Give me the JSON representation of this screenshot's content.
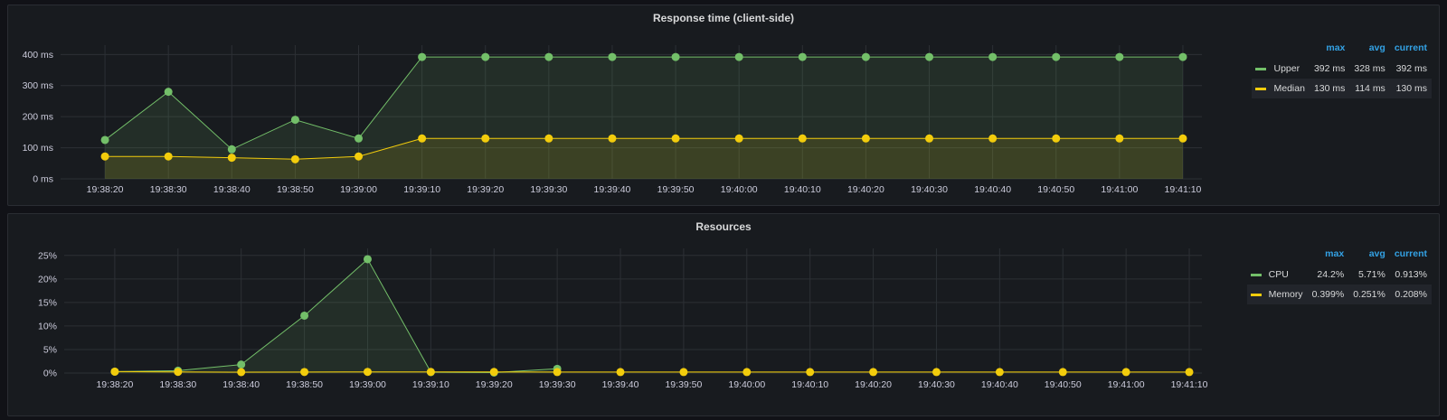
{
  "colors": {
    "green": "#73bf69",
    "yellow": "#f2cc0c",
    "grid": "#2c3035",
    "text": "#ccccdc"
  },
  "panels": [
    {
      "title": "Response time (client-side)",
      "legend_headers": [
        "max",
        "avg",
        "current"
      ],
      "legend": [
        {
          "name": "Upper",
          "color": "#73bf69",
          "max": "392 ms",
          "avg": "328 ms",
          "current": "392 ms"
        },
        {
          "name": "Median",
          "color": "#f2cc0c",
          "max": "130 ms",
          "avg": "114 ms",
          "current": "130 ms"
        }
      ]
    },
    {
      "title": "Resources",
      "legend_headers": [
        "max",
        "avg",
        "current"
      ],
      "legend": [
        {
          "name": "CPU",
          "color": "#73bf69",
          "max": "24.2%",
          "avg": "5.71%",
          "current": "0.913%"
        },
        {
          "name": "Memory",
          "color": "#f2cc0c",
          "max": "0.399%",
          "avg": "0.251%",
          "current": "0.208%"
        }
      ]
    }
  ],
  "chart_data": [
    {
      "type": "area",
      "title": "Response time (client-side)",
      "x_type": "time",
      "x_range": [
        "19:38:13",
        "19:41:13"
      ],
      "x_ticks": [
        "19:38:20",
        "19:38:30",
        "19:38:40",
        "19:38:50",
        "19:39:00",
        "19:39:10",
        "19:39:20",
        "19:39:30",
        "19:39:40",
        "19:39:50",
        "19:40:00",
        "19:40:10",
        "19:40:20",
        "19:40:30",
        "19:40:40",
        "19:40:50",
        "19:41:00",
        "19:41:10"
      ],
      "y_range": [
        0,
        430
      ],
      "y_ticks": [
        0,
        100,
        200,
        300,
        400
      ],
      "y_tick_labels": [
        "0 ms",
        "100 ms",
        "200 ms",
        "300 ms",
        "400 ms"
      ],
      "x": [
        "19:38:20",
        "19:38:30",
        "19:38:40",
        "19:38:50",
        "19:39:00",
        "19:39:10",
        "19:39:20",
        "19:39:30",
        "19:39:40",
        "19:39:50",
        "19:40:00",
        "19:40:10",
        "19:40:20",
        "19:40:30",
        "19:40:40",
        "19:40:50",
        "19:41:00",
        "19:41:10"
      ],
      "series": [
        {
          "name": "Upper",
          "color": "#73bf69",
          "values": [
            125,
            280,
            95,
            190,
            130,
            392,
            392,
            392,
            392,
            392,
            392,
            392,
            392,
            392,
            392,
            392,
            392,
            392
          ]
        },
        {
          "name": "Median",
          "color": "#f2cc0c",
          "values": [
            72,
            72,
            68,
            63,
            72,
            130,
            130,
            130,
            130,
            130,
            130,
            130,
            130,
            130,
            130,
            130,
            130,
            130
          ]
        }
      ]
    },
    {
      "type": "area",
      "title": "Resources",
      "x_type": "time",
      "x_range": [
        "19:38:12",
        "19:41:12"
      ],
      "x_ticks": [
        "19:38:20",
        "19:38:30",
        "19:38:40",
        "19:38:50",
        "19:39:00",
        "19:39:10",
        "19:39:20",
        "19:39:30",
        "19:39:40",
        "19:39:50",
        "19:40:00",
        "19:40:10",
        "19:40:20",
        "19:40:30",
        "19:40:40",
        "19:40:50",
        "19:41:00",
        "19:41:10"
      ],
      "y_range": [
        0,
        26.5
      ],
      "y_ticks": [
        0,
        5,
        10,
        15,
        20,
        25
      ],
      "y_tick_labels": [
        "0%",
        "5%",
        "10%",
        "15%",
        "20%",
        "25%"
      ],
      "series": [
        {
          "name": "CPU",
          "color": "#73bf69",
          "x": [
            "19:38:20",
            "19:38:30",
            "19:38:40",
            "19:38:50",
            "19:39:00",
            "19:39:10",
            "19:39:20",
            "19:39:30"
          ],
          "values": [
            0.3,
            0.5,
            1.8,
            12.2,
            24.2,
            0.2,
            0.1,
            0.9
          ]
        },
        {
          "name": "Memory",
          "color": "#f2cc0c",
          "x": [
            "19:38:20",
            "19:38:30",
            "19:38:40",
            "19:38:50",
            "19:39:00",
            "19:39:10",
            "19:39:20",
            "19:39:30",
            "19:39:40",
            "19:39:50",
            "19:40:00",
            "19:40:10",
            "19:40:20",
            "19:40:30",
            "19:40:40",
            "19:40:50",
            "19:41:00",
            "19:41:10"
          ],
          "values": [
            0.3,
            0.25,
            0.2,
            0.22,
            0.25,
            0.24,
            0.23,
            0.21,
            0.21,
            0.21,
            0.21,
            0.21,
            0.21,
            0.21,
            0.21,
            0.21,
            0.21,
            0.21
          ]
        }
      ]
    }
  ]
}
